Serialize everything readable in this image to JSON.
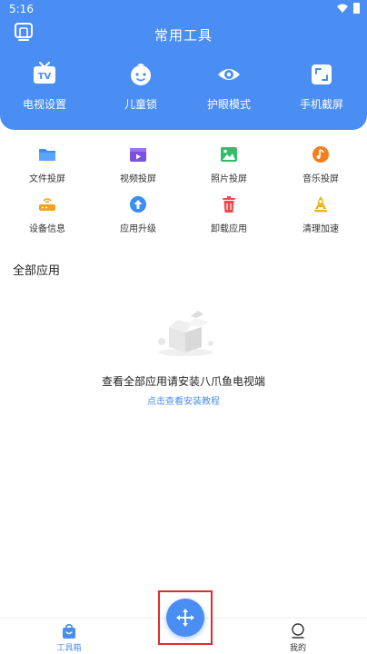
{
  "status_bar": {
    "time": "5:16"
  },
  "header": {
    "title": "常用工具"
  },
  "big_tools": [
    {
      "label": "电视设置",
      "icon": "tv-icon"
    },
    {
      "label": "儿童锁",
      "icon": "child-face-icon"
    },
    {
      "label": "护眼模式",
      "icon": "eye-icon"
    },
    {
      "label": "手机截屏",
      "icon": "screenshot-icon"
    }
  ],
  "small_tools": [
    {
      "label": "文件投屏",
      "icon": "folder-icon",
      "color": "#3b8ff0"
    },
    {
      "label": "视频投屏",
      "icon": "video-icon",
      "color": "#7b4fe0"
    },
    {
      "label": "照片投屏",
      "icon": "photo-icon",
      "color": "#2fbf6b"
    },
    {
      "label": "音乐投屏",
      "icon": "music-icon",
      "color": "#f27f1b"
    },
    {
      "label": "设备信息",
      "icon": "router-icon",
      "color": "#f2a31b"
    },
    {
      "label": "应用升级",
      "icon": "upgrade-icon",
      "color": "#3b8ff0"
    },
    {
      "label": "卸载应用",
      "icon": "trash-icon",
      "color": "#f24848"
    },
    {
      "label": "清理加速",
      "icon": "rocket-icon",
      "color": "#f2b21b"
    }
  ],
  "apps_section": {
    "title": "全部应用",
    "empty_message": "查看全部应用请安装八爪鱼电视端",
    "empty_link": "点击查看安装教程"
  },
  "bottom_nav": {
    "tools_label": "工具箱",
    "mine_label": "我的"
  },
  "colors": {
    "accent": "#4a8df3",
    "highlight_border": "#e12b2b"
  }
}
